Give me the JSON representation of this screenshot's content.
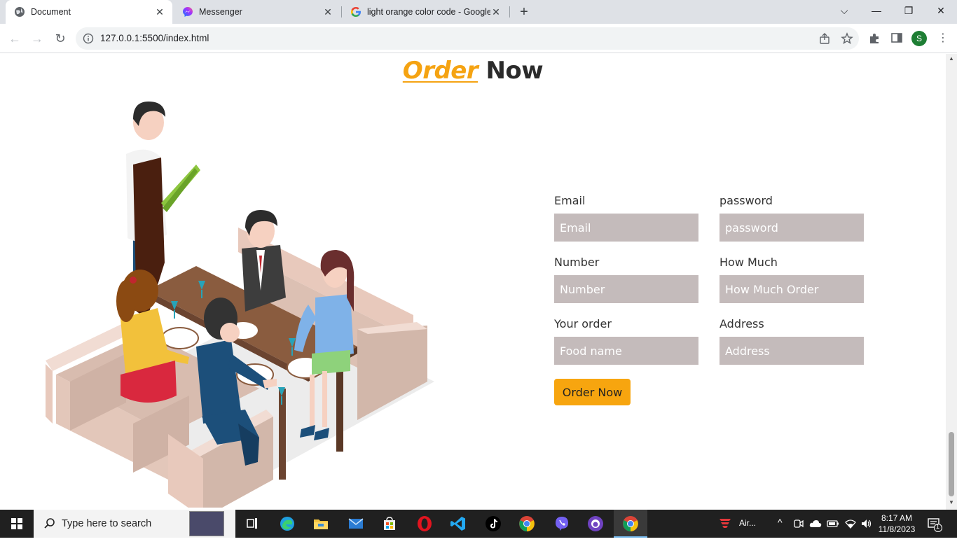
{
  "browser": {
    "tabs": [
      {
        "title": "Document",
        "active": true
      },
      {
        "title": "Messenger",
        "active": false
      },
      {
        "title": "light orange color code - Google",
        "active": false
      }
    ],
    "address": "127.0.0.1:5500/index.html",
    "profile_initial": "S"
  },
  "page": {
    "heading_highlight": "Order",
    "heading_rest": " Now",
    "form": {
      "email_label": "Email",
      "email_placeholder": "Email",
      "password_label": "password",
      "password_placeholder": "password",
      "number_label": "Number",
      "number_placeholder": "Number",
      "howmuch_label": "How Much",
      "howmuch_placeholder": "How Much Order",
      "order_label": "Your order",
      "order_placeholder": "Food name",
      "address_label": "Address",
      "address_placeholder": "Address",
      "submit_label": "Order Now"
    }
  },
  "taskbar": {
    "search_placeholder": "Type here to search",
    "weather_label": "Air...",
    "time": "8:17 AM",
    "date": "11/8/2023",
    "notification_count": "1"
  },
  "colors": {
    "accent": "#f5a312",
    "input_bg": "#c4bbbb",
    "button_bg": "#f7a50f"
  }
}
